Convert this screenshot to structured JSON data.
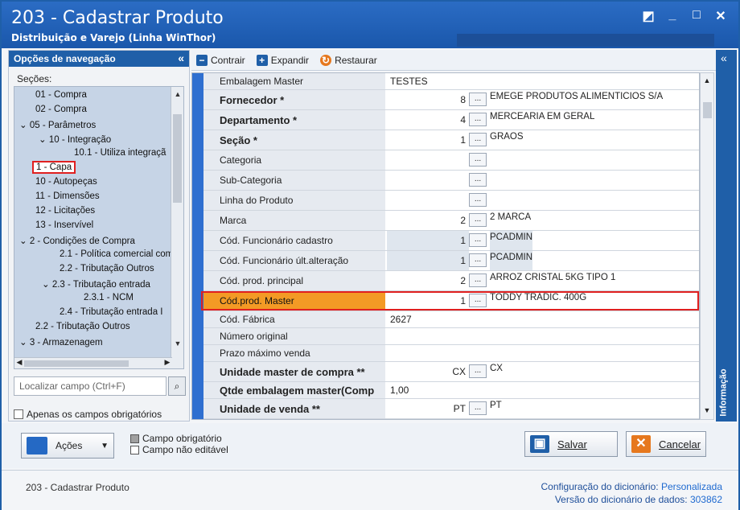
{
  "window": {
    "title": "203 - Cadastrar  Produto",
    "subtitle": "Distribuição e Varejo (Linha WinThor)",
    "controls": [
      "◩",
      "_",
      "□",
      "✕"
    ]
  },
  "nav": {
    "header": "Opções de navegação",
    "collapse": "«",
    "sections_label": "Seções:",
    "tree": [
      {
        "label": "01 - Compra"
      },
      {
        "label": "02 - Compra"
      },
      {
        "label": "05 - Parâmetros"
      },
      {
        "label": "10 - Integração"
      },
      {
        "label": "10.1 - Utiliza integraçã"
      },
      {
        "label": "1 - Capa",
        "selected": true
      },
      {
        "label": "10 - Autopeças"
      },
      {
        "label": "11 - Dimensões"
      },
      {
        "label": "12 - Licitações"
      },
      {
        "label": "13 - Inservível"
      },
      {
        "label": "2 - Condições de Compra"
      },
      {
        "label": "2.1 - Política comercial com"
      },
      {
        "label": "2.2 - Tributação Outros"
      },
      {
        "label": "2.3 - Tributação entrada"
      },
      {
        "label": "2.3.1 - NCM"
      },
      {
        "label": "2.4 - Tributação entrada I"
      },
      {
        "label": "2.2 - Tributação Outros"
      },
      {
        "label": "3 - Armazenagem"
      }
    ],
    "search_placeholder": "Localizar campo (Ctrl+F)",
    "only_required": "Apenas os campos obrigatórios"
  },
  "toolbar": {
    "contrair": "Contrair",
    "expandir": "Expandir",
    "restaurar": "Restaurar"
  },
  "grid": {
    "rows": [
      {
        "label": "Embalagem Master",
        "code": "TESTES",
        "desc": "",
        "bold": false,
        "btn": false,
        "code_left": true
      },
      {
        "label": "Fornecedor *",
        "code": "8",
        "desc": "EMEGE PRODUTOS ALIMENTICIOS S/A",
        "bold": true,
        "btn": true
      },
      {
        "label": "Departamento *",
        "code": "4",
        "desc": "MERCEARIA EM GERAL",
        "bold": true,
        "btn": true
      },
      {
        "label": "Seção *",
        "code": "1",
        "desc": "GRAOS",
        "bold": true,
        "btn": true
      },
      {
        "label": "Categoria",
        "code": "",
        "desc": "",
        "bold": false,
        "btn": true
      },
      {
        "label": "Sub-Categoria",
        "code": "",
        "desc": "",
        "bold": false,
        "btn": true
      },
      {
        "label": "Linha do Produto",
        "code": "",
        "desc": "",
        "bold": false,
        "btn": true
      },
      {
        "label": "Marca",
        "code": "2",
        "desc": "2 MARCA",
        "bold": false,
        "btn": true
      },
      {
        "label": "Cód. Funcionário cadastro",
        "code": "1",
        "desc": "PCADMIN",
        "bold": false,
        "btn": true,
        "shade": true
      },
      {
        "label": "Cód. Funcionário últ.alteração",
        "code": "1",
        "desc": "PCADMIN",
        "bold": false,
        "btn": true,
        "shade": true
      },
      {
        "label": "Cód. prod. principal",
        "code": "2",
        "desc": "ARROZ CRISTAL 5KG TIPO 1",
        "bold": false,
        "btn": true
      },
      {
        "label": "Cód.prod. Master",
        "code": "1",
        "desc": "TODDY TRADIC. 400G",
        "bold": false,
        "btn": true,
        "highlight": true
      },
      {
        "label": "Cód. Fábrica",
        "code": "2627",
        "desc": "",
        "bold": false,
        "btn": false,
        "code_left": true
      },
      {
        "label": "Número original",
        "code": "",
        "desc": "",
        "bold": false,
        "btn": false
      },
      {
        "label": "Prazo máximo venda",
        "code": "",
        "desc": "",
        "bold": false,
        "btn": false
      },
      {
        "label": "Unidade master de compra **",
        "code": "CX",
        "desc": "CX",
        "bold": true,
        "btn": true
      },
      {
        "label": "Qtde embalagem master(Comp",
        "code": "1,00",
        "desc": "",
        "bold": true,
        "btn": false,
        "code_left": true
      },
      {
        "label": "Unidade de venda **",
        "code": "PT",
        "desc": "PT",
        "bold": true,
        "btn": true
      }
    ],
    "ellipsis": "..."
  },
  "info_tab": {
    "label": "Informação",
    "collapse": "«"
  },
  "footer": {
    "acoes": "Ações",
    "legend_required": "Campo obrigatório",
    "legend_readonly": "Campo não editável",
    "salvar": "Salvar",
    "cancelar": "Cancelar"
  },
  "status": {
    "left": "203 - Cadastrar  Produto",
    "dict_config_label": "Configuração do dicionário:",
    "dict_config_value": "Personalizada",
    "dict_version_label": "Versão do dicionário de dados:",
    "dict_version_value": "303862"
  }
}
